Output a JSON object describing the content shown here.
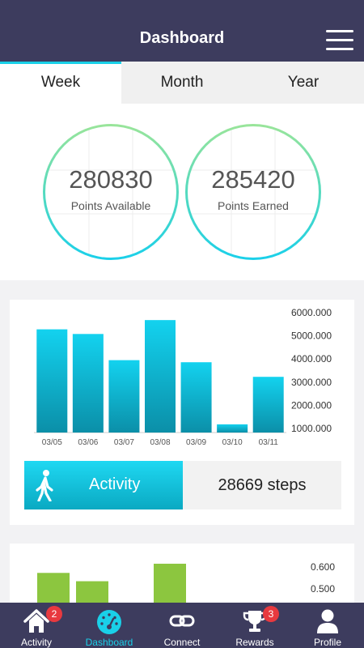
{
  "header": {
    "title": "Dashboard",
    "menu_icon": "hamburger-menu-icon"
  },
  "tabs": [
    {
      "label": "Week",
      "active": true
    },
    {
      "label": "Month",
      "active": false
    },
    {
      "label": "Year",
      "active": false
    }
  ],
  "points": {
    "available": {
      "value": "280830",
      "label": "Points Available"
    },
    "earned": {
      "value": "285420",
      "label": "Points Earned"
    }
  },
  "chart_data": [
    {
      "type": "bar",
      "categories": [
        "03/05",
        "03/06",
        "03/07",
        "03/08",
        "03/09",
        "03/10",
        "03/11"
      ],
      "values": [
        5280,
        5080,
        3950,
        5680,
        3860,
        1180,
        3230
      ],
      "y_tick_labels": [
        "6000.000",
        "5000.000",
        "4000.000",
        "3000.000",
        "2000.000",
        "1000.000"
      ],
      "ylim": [
        750,
        6000
      ],
      "color": "#0fb6d0",
      "grid": false
    },
    {
      "type": "bar",
      "values": [
        0.573,
        0.535,
        0.615
      ],
      "y_tick_labels": [
        "0.600",
        "0.500"
      ],
      "color": "#8cc63f",
      "grid": false
    }
  ],
  "activity": {
    "label": "Activity",
    "steps": "28669 steps",
    "icon": "walking-person-icon"
  },
  "colors": {
    "header": "#3d3c5e",
    "accent": "#1ad0e8",
    "bar": "#0fb6d0",
    "bar2": "#8cc63f",
    "badge": "#e8393f"
  },
  "nav": [
    {
      "label": "Activity",
      "icon": "home-icon",
      "badge": "2",
      "active": false
    },
    {
      "label": "Dashboard",
      "icon": "dashboard-gauge-icon",
      "badge": "",
      "active": true
    },
    {
      "label": "Connect",
      "icon": "link-icon",
      "badge": "",
      "active": false
    },
    {
      "label": "Rewards",
      "icon": "trophy-icon",
      "badge": "3",
      "active": false
    },
    {
      "label": "Profile",
      "icon": "user-icon",
      "badge": "",
      "active": false
    }
  ]
}
